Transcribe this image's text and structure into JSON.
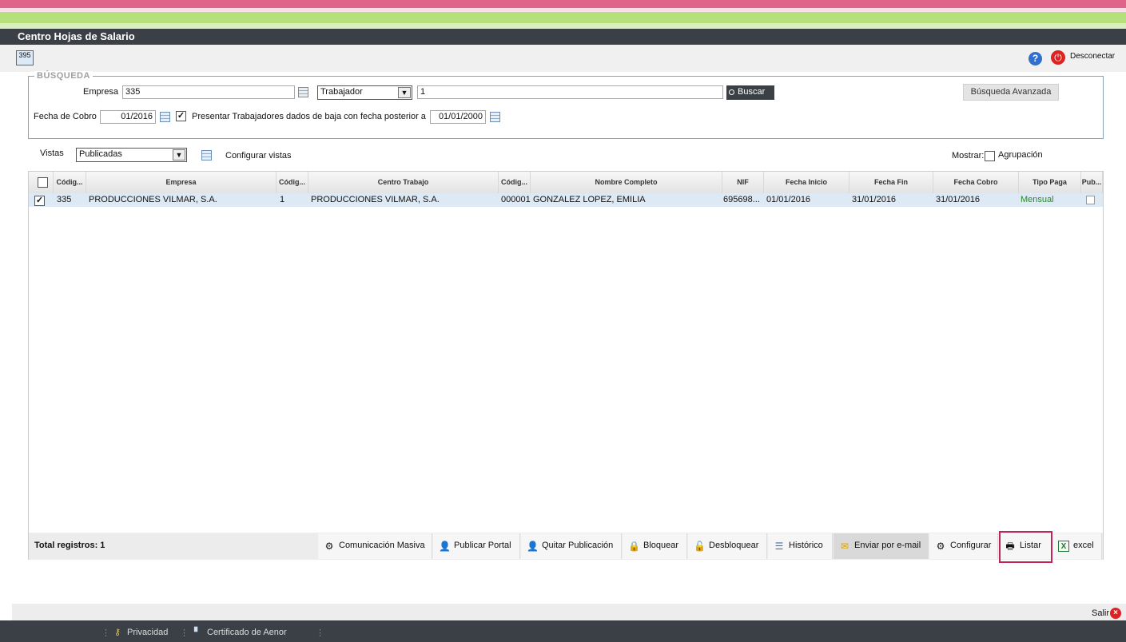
{
  "window": {
    "title": "Centro Hojas de Salario",
    "app_icon_label": "395"
  },
  "header": {
    "help_label": "?",
    "disconnect_label": "Desconectar"
  },
  "search": {
    "legend": "BÚSQUEDA",
    "empresa_label": "Empresa",
    "empresa_value": "335",
    "type_select": "Trabajador",
    "query_value": "1",
    "buscar_label": "Buscar",
    "advanced_label": "Búsqueda Avanzada",
    "fecha_cobro_label": "Fecha de Cobro",
    "fecha_cobro_value": "01/2016",
    "presentar_label": "Presentar Trabajadores dados de baja con fecha posterior a",
    "presentar_checked": true,
    "presentar_date": "01/01/2000"
  },
  "views": {
    "label": "Vistas",
    "selected": "Publicadas",
    "configure_label": "Configurar vistas",
    "mostrar_label": "Mostrar:",
    "agrupacion_label": "Agrupación"
  },
  "grid": {
    "columns": [
      "Códig...",
      "Empresa",
      "Códig...",
      "Centro Trabajo",
      "Códig...",
      "Nombre Completo",
      "NIF",
      "Fecha Inicio",
      "Fecha Fin",
      "Fecha Cobro",
      "Tipo Paga",
      "Pub..."
    ],
    "rows": [
      {
        "checked": true,
        "cod_empresa": "335",
        "empresa": "PRODUCCIONES VILMAR, S.A.",
        "cod_centro": "1",
        "centro": "PRODUCCIONES VILMAR, S.A.",
        "cod_trab": "000001",
        "nombre": "GONZALEZ LOPEZ, EMILIA",
        "nif": "695698...",
        "fecha_inicio": "01/01/2016",
        "fecha_fin": "31/01/2016",
        "fecha_cobro": "31/01/2016",
        "tipo_paga": "Mensual",
        "publicado": false
      }
    ],
    "total_label": "Total registros: 1",
    "actions": [
      "Comunicación Masiva",
      "Publicar Portal",
      "Quitar Publicación",
      "Bloquear",
      "Desbloquear",
      "Histórico",
      "Enviar por e-mail",
      "Configurar",
      "Listar",
      "excel"
    ]
  },
  "bottom": {
    "salir_label": "Salir",
    "privacidad_label": "Privacidad",
    "certificado_label": "Certificado de Aenor"
  },
  "colors": {
    "top_stripe": "#e0648a",
    "green_stripe": "#b6e07c",
    "titlebar": "#3b4046",
    "mensual": "#2a8a2a",
    "highlight": "#c0245c"
  }
}
